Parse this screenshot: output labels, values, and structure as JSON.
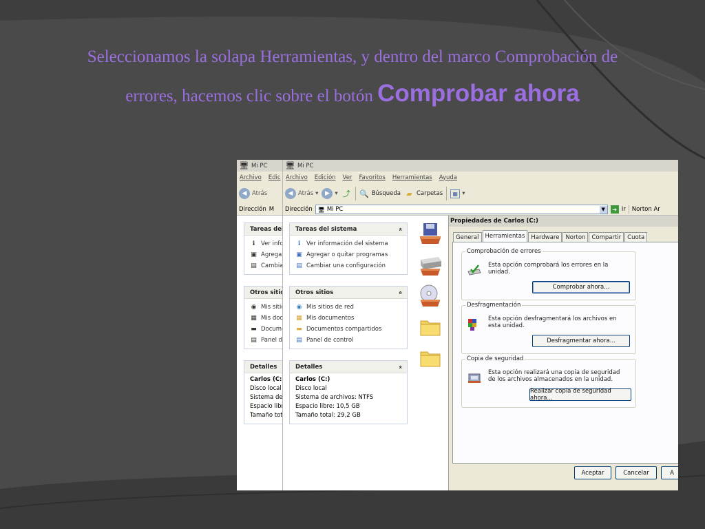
{
  "slide": {
    "title_line1": "Seleccionamos la solapa Herramientas, y dentro del marco Comprobación de",
    "title_line2": "errores, hacemos clic sobre el botón",
    "title_bold": "Comprobar ahora",
    "colors": {
      "title": "#9b6fe0",
      "background": "#4a4a4a",
      "dialog_bg": "#ece9d8"
    }
  },
  "window_back": {
    "title": "Mi PC",
    "menu": [
      "Archivo",
      "Edic"
    ],
    "back_label": "Atrás",
    "address_label": "Dirección",
    "address_value": "M",
    "panels": [
      {
        "title": "Tareas del",
        "items": [
          "Ver info",
          "Agrega",
          "Cambia"
        ]
      },
      {
        "title": "Otros sitio",
        "items": [
          "Mis sitic",
          "Mis doc",
          "Docume",
          "Panel d"
        ]
      },
      {
        "title": "Detalles",
        "lines": [
          "Carlos (C:)",
          "Disco local",
          "Sistema de",
          "Espacio libre",
          "Tamaño total"
        ]
      }
    ]
  },
  "window_front": {
    "title": "Mi PC",
    "menu": [
      "Archivo",
      "Edición",
      "Ver",
      "Favoritos",
      "Herramientas",
      "Ayuda"
    ],
    "toolbar": {
      "back": "Atrás",
      "search": "Búsqueda",
      "folders": "Carpetas"
    },
    "address_label": "Dirección",
    "address_value": "Mi PC",
    "go_label": "Ir",
    "links_label": "Norton Ar",
    "panels": [
      {
        "title": "Tareas del sistema",
        "items": [
          "Ver información del sistema",
          "Agregar o quitar programas",
          "Cambiar una configuración"
        ]
      },
      {
        "title": "Otros sitios",
        "items": [
          "Mis sitios de red",
          "Mis documentos",
          "Documentos compartidos",
          "Panel de control"
        ]
      },
      {
        "title": "Detalles",
        "name": "Carlos (C:)",
        "lines": [
          "Disco local",
          "Sistema de archivos: NTFS",
          "Espacio libre: 10,5 GB",
          "Tamaño total: 29,2 GB"
        ]
      }
    ],
    "collapse_glyph": "«"
  },
  "dialog": {
    "title": "Propiedades de Carlos (C:)",
    "tabs": [
      "General",
      "Herramientas",
      "Hardware",
      "Norton",
      "Compartir",
      "Cuota"
    ],
    "active_tab": "Herramientas",
    "groups": [
      {
        "label": "Comprobación de errores",
        "text": "Esta opción comprobará los errores en la unidad.",
        "button": "Comprobar ahora..."
      },
      {
        "label": "Desfragmentación",
        "text": "Esta opción desfragmentará los archivos en esta unidad.",
        "button": "Desfragmentar ahora..."
      },
      {
        "label": "Copia de seguridad",
        "text": "Esta opción realizará una copia de seguridad de los archivos almacenados en la unidad.",
        "button": "Realizar copia de seguridad ahora..."
      }
    ],
    "ok_label": "Aceptar",
    "cancel_label": "Cancelar",
    "apply_label": "A"
  }
}
